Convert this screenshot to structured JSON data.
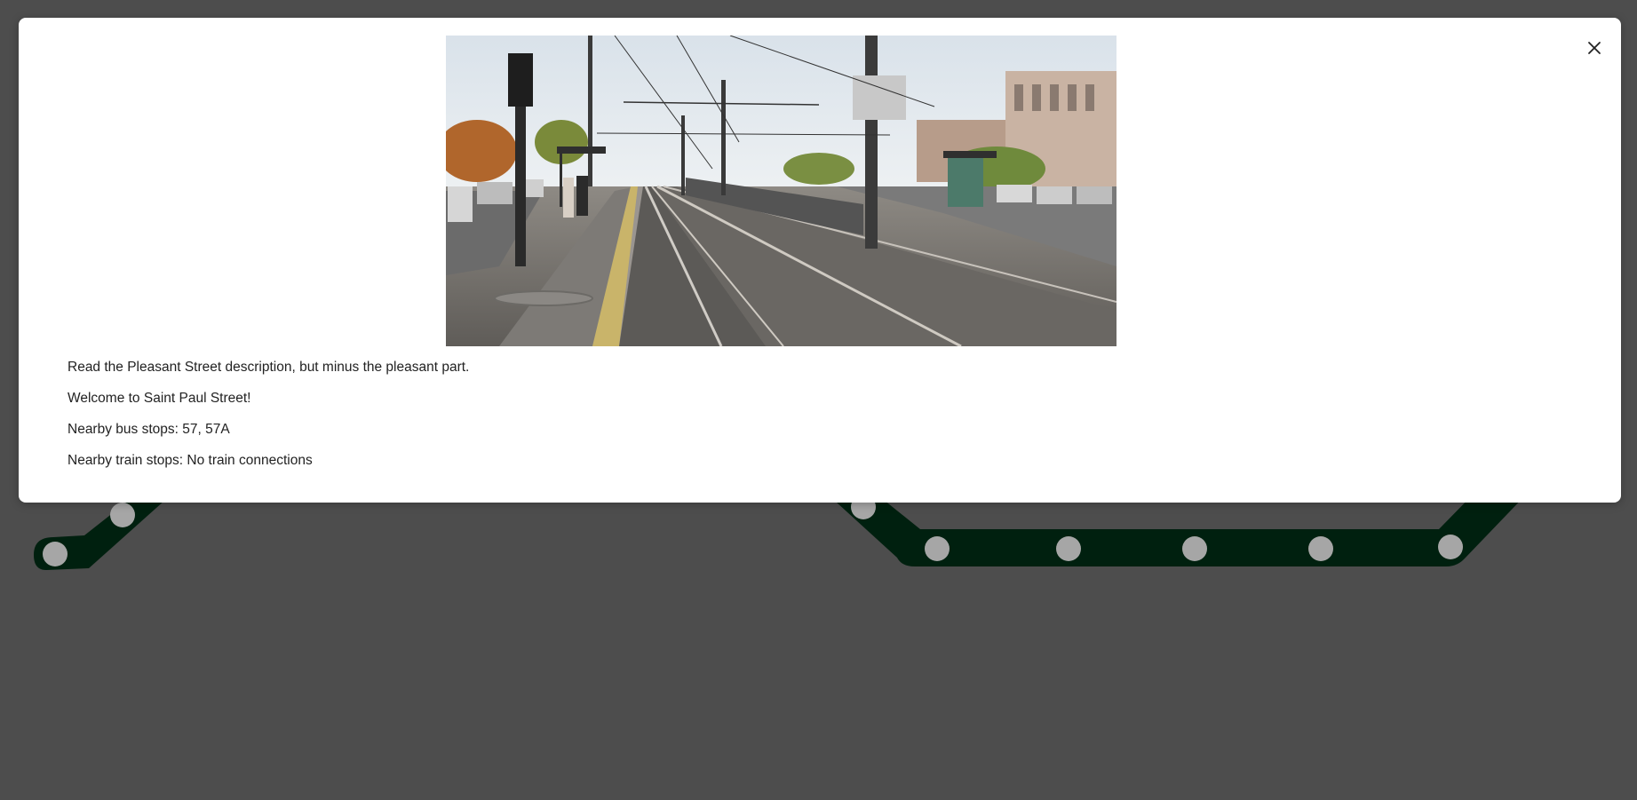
{
  "modal": {
    "photo_alt": "Saint Paul Street station platform",
    "description": "Read the Pleasant Street description, but minus the pleasant part.",
    "welcome": "Welcome to Saint Paul Street!",
    "bus_stops": "Nearby bus stops: 57, 57A",
    "train_stops": "Nearby train stops: No train connections",
    "close_icon": "close-icon"
  },
  "colors": {
    "backdrop": "#4d4d4d",
    "line": "#00200f",
    "stop": "#a6a6a6",
    "modal_bg": "#ffffff"
  }
}
